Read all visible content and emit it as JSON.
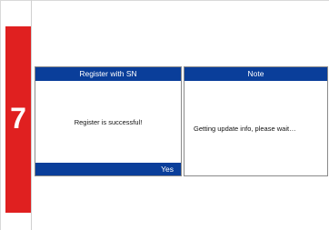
{
  "step": {
    "number": "7"
  },
  "dialogs": {
    "register": {
      "title": "Register with SN",
      "message": "Register is successful!",
      "button": "Yes"
    },
    "note": {
      "title": "Note",
      "message": "Getting update info, please wait…"
    }
  },
  "colors": {
    "step_bar": "#e02020",
    "dialog_header": "#0a3e9a"
  }
}
